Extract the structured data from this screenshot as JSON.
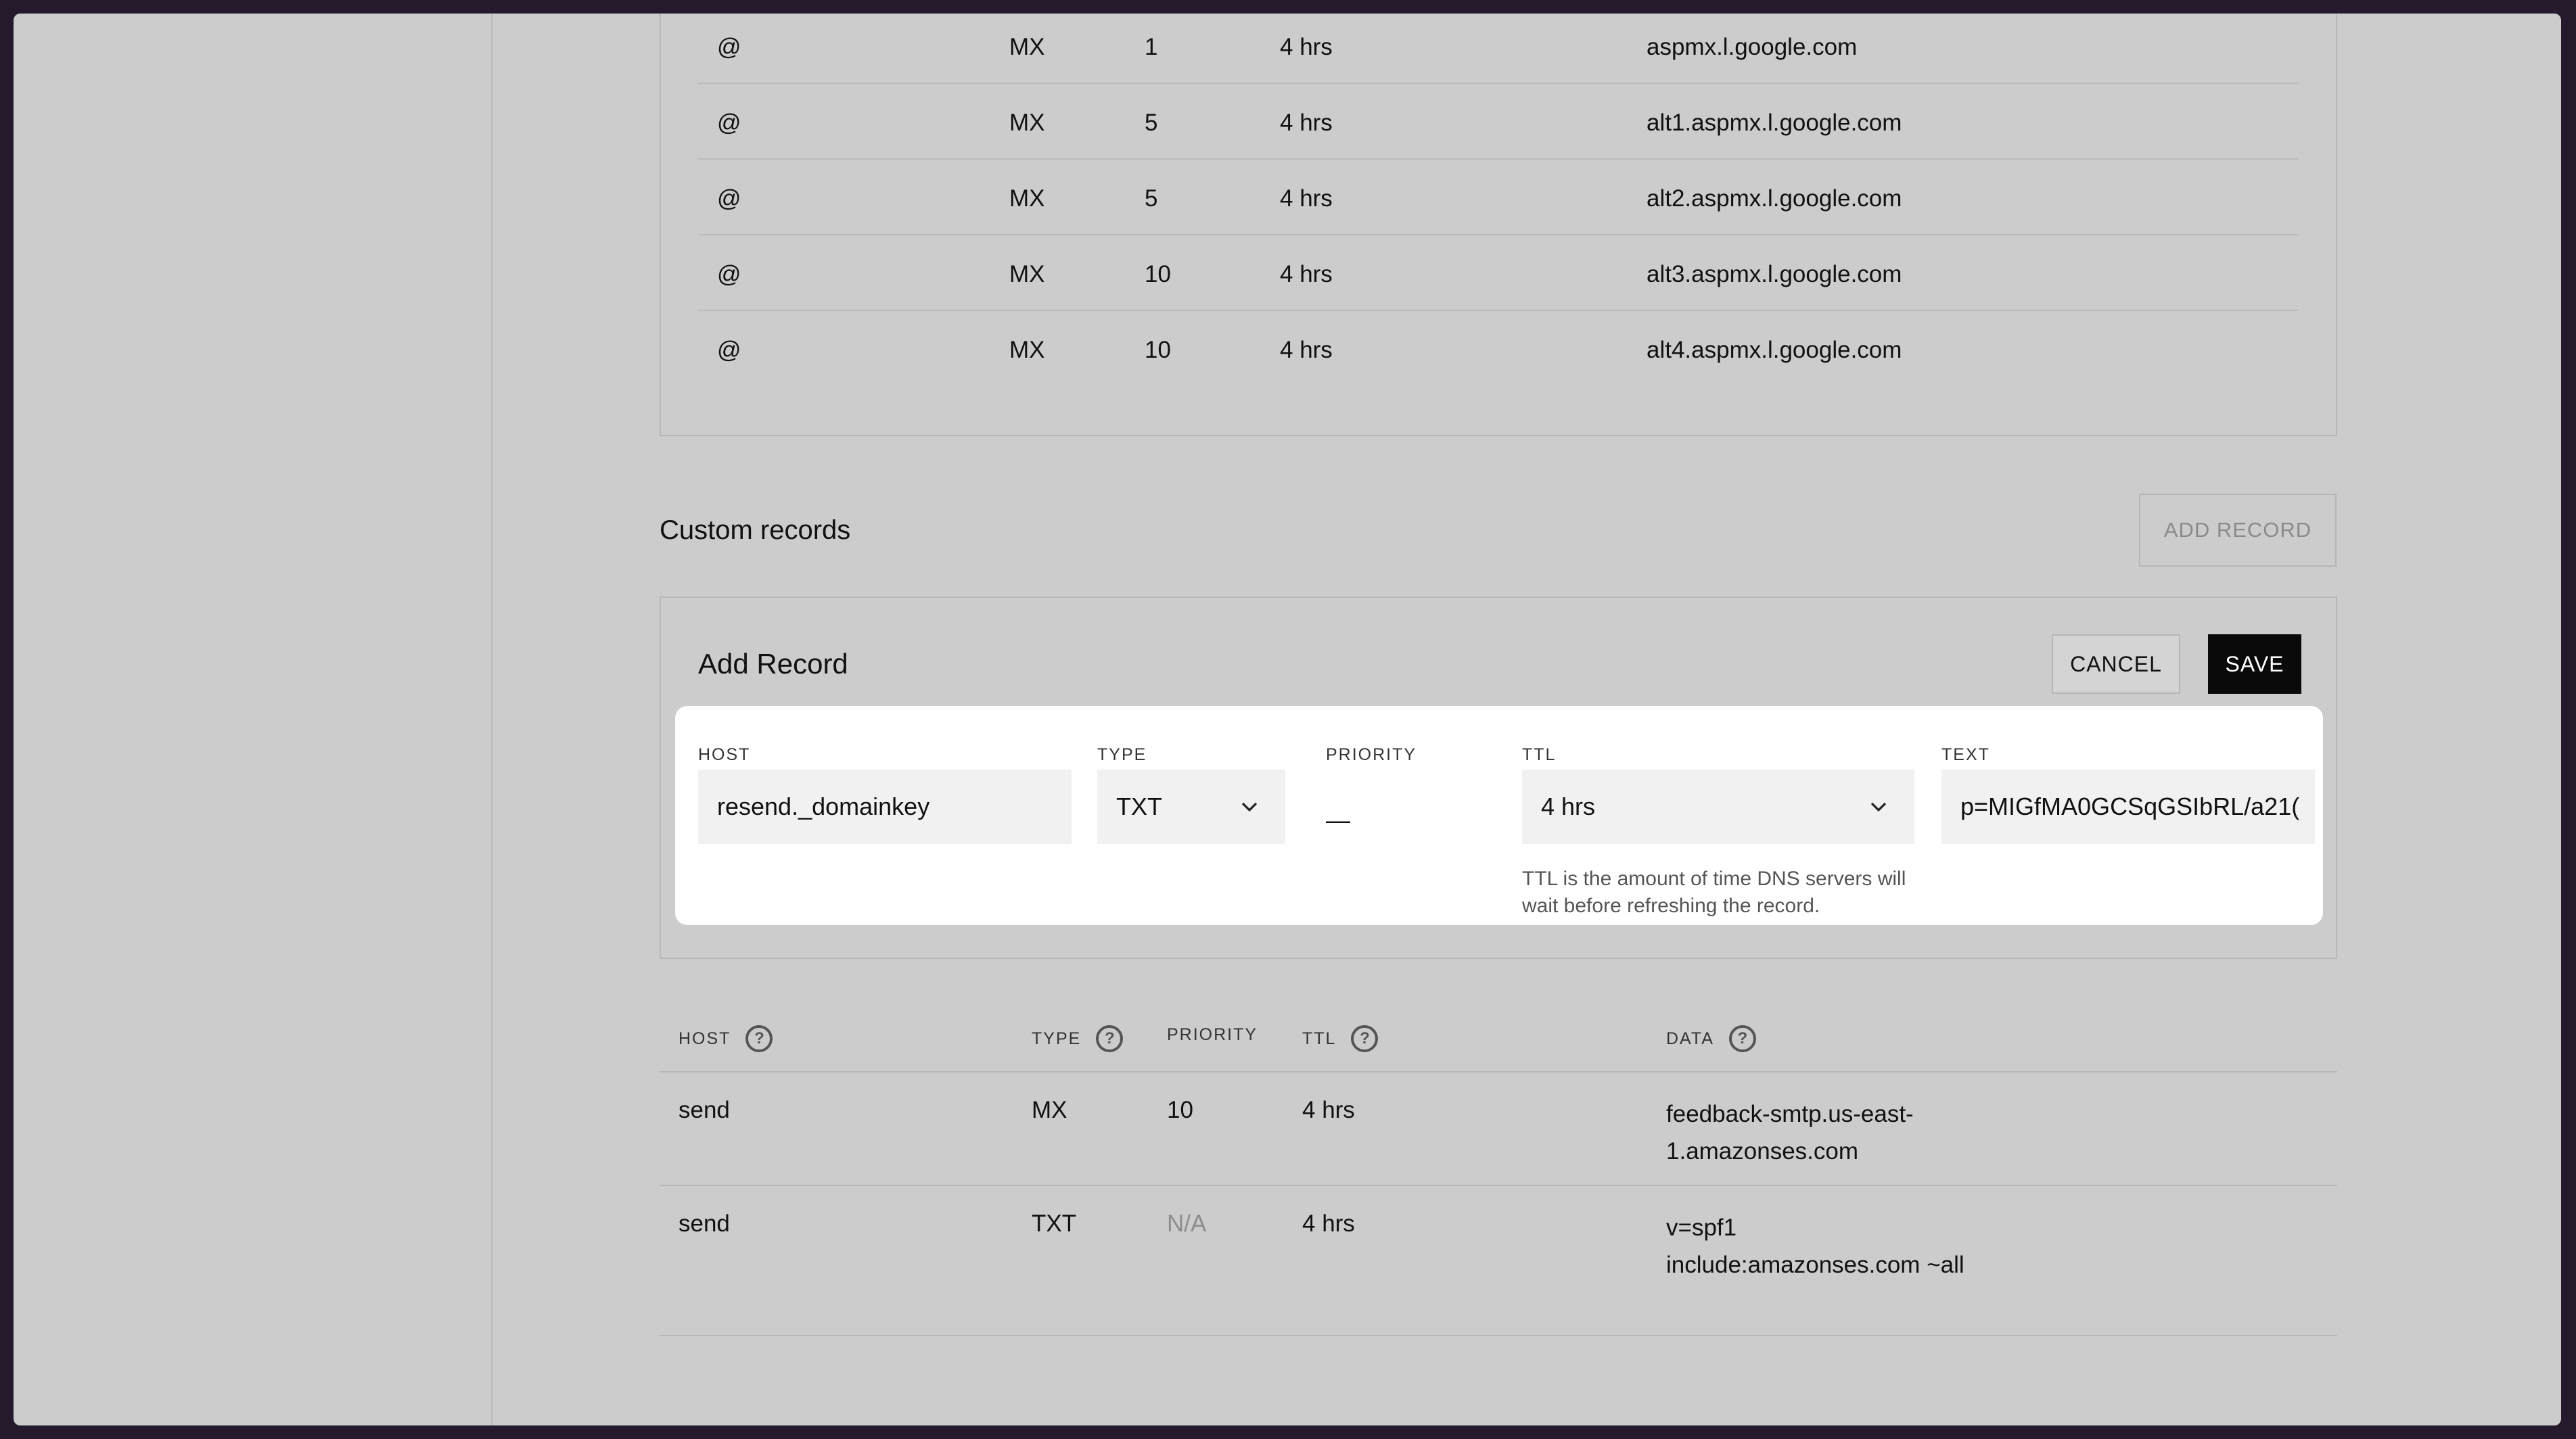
{
  "mx_records": [
    {
      "host": "@",
      "type": "MX",
      "priority": "1",
      "ttl": "4 hrs",
      "data": "aspmx.l.google.com"
    },
    {
      "host": "@",
      "type": "MX",
      "priority": "5",
      "ttl": "4 hrs",
      "data": "alt1.aspmx.l.google.com"
    },
    {
      "host": "@",
      "type": "MX",
      "priority": "5",
      "ttl": "4 hrs",
      "data": "alt2.aspmx.l.google.com"
    },
    {
      "host": "@",
      "type": "MX",
      "priority": "10",
      "ttl": "4 hrs",
      "data": "alt3.aspmx.l.google.com"
    },
    {
      "host": "@",
      "type": "MX",
      "priority": "10",
      "ttl": "4 hrs",
      "data": "alt4.aspmx.l.google.com"
    }
  ],
  "custom": {
    "title": "Custom records",
    "add_record_label": "ADD RECORD"
  },
  "add_form": {
    "title": "Add Record",
    "cancel_label": "CANCEL",
    "save_label": "SAVE",
    "labels": {
      "host": "HOST",
      "type": "TYPE",
      "priority": "PRIORITY",
      "ttl": "TTL",
      "text": "TEXT"
    },
    "host_value": "resend._domainkey",
    "type_value": "TXT",
    "priority_value": "—",
    "ttl_value": "4 hrs",
    "text_value": "p=MIGfMA0GCSqGSIbRL/a21(",
    "ttl_help": "TTL is the amount of time DNS servers will wait before refreshing the record."
  },
  "records_table": {
    "headers": {
      "host": "HOST",
      "type": "TYPE",
      "priority": "PRIORITY",
      "ttl": "TTL",
      "data": "DATA"
    },
    "rows": [
      {
        "host": "send",
        "type": "MX",
        "priority": "10",
        "ttl": "4 hrs",
        "data": "feedback-smtp.us-east-1.amazonses.com"
      },
      {
        "host": "send",
        "type": "TXT",
        "priority": "N/A",
        "ttl": "4 hrs",
        "data": "v=spf1 include:amazonses.com ~all"
      }
    ]
  },
  "icons": [
    "help-icon",
    "chevron-down-icon"
  ],
  "colors": {
    "background": "#cccccc",
    "save_button": "#0a0a0a",
    "card": "#ffffff"
  }
}
